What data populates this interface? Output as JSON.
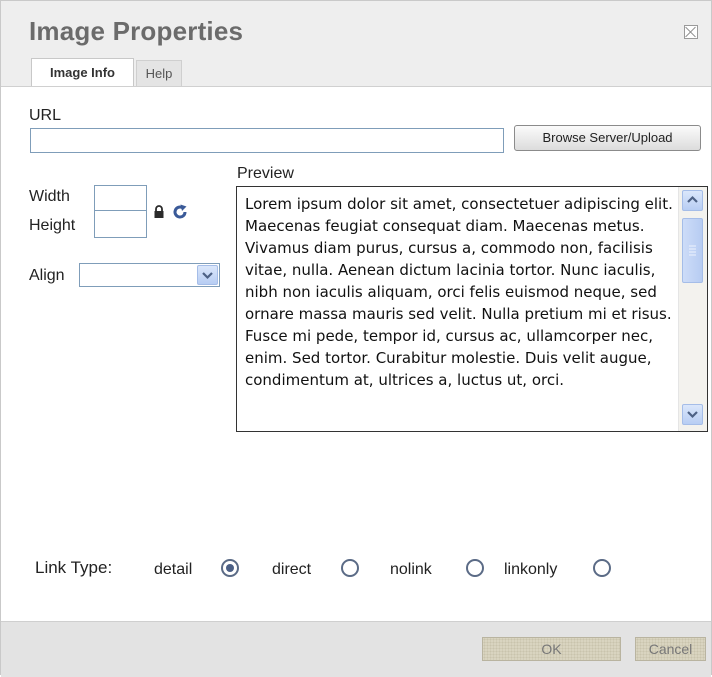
{
  "dialog": {
    "title": "Image Properties",
    "tabs": [
      {
        "label": "Image Info",
        "active": true
      },
      {
        "label": "Help",
        "active": false
      }
    ]
  },
  "form": {
    "url_label": "URL",
    "url_value": "",
    "browse_label": "Browse Server/Upload",
    "width_label": "Width",
    "width_value": "",
    "height_label": "Height",
    "height_value": "",
    "align_label": "Align",
    "align_value": "",
    "preview_label": "Preview",
    "preview_text": "Lorem ipsum dolor sit amet, consectetuer adipiscing elit. Maecenas feugiat consequat diam. Maecenas metus. Vivamus diam purus, cursus a, commodo non, facilisis vitae, nulla. Aenean dictum lacinia tortor. Nunc iaculis, nibh non iaculis aliquam, orci felis euismod neque, sed ornare massa mauris sed velit. Nulla pretium mi et risus. Fusce mi pede, tempor id, cursus ac, ullamcorper nec, enim. Sed tortor. Curabitur molestie. Duis velit augue, condimentum at, ultrices a, luctus ut, orci."
  },
  "link_type": {
    "label": "Link Type:",
    "options": [
      {
        "label": "detail",
        "checked": true
      },
      {
        "label": "direct",
        "checked": false
      },
      {
        "label": "nolink",
        "checked": false
      },
      {
        "label": "linkonly",
        "checked": false
      }
    ]
  },
  "footer": {
    "ok_label": "OK",
    "cancel_label": "Cancel"
  },
  "icons": {
    "close": "close-icon",
    "lock": "lock-icon",
    "reset": "reset-size-icon",
    "dropdown": "chevron-down-icon"
  },
  "colors": {
    "title_text": "#6b6b6b",
    "title_bar_bg": "#eeeeee",
    "input_border": "#7f9db9",
    "icon_blue": "#3a5a98",
    "scrollbar_blue": "#b7cdf3"
  }
}
